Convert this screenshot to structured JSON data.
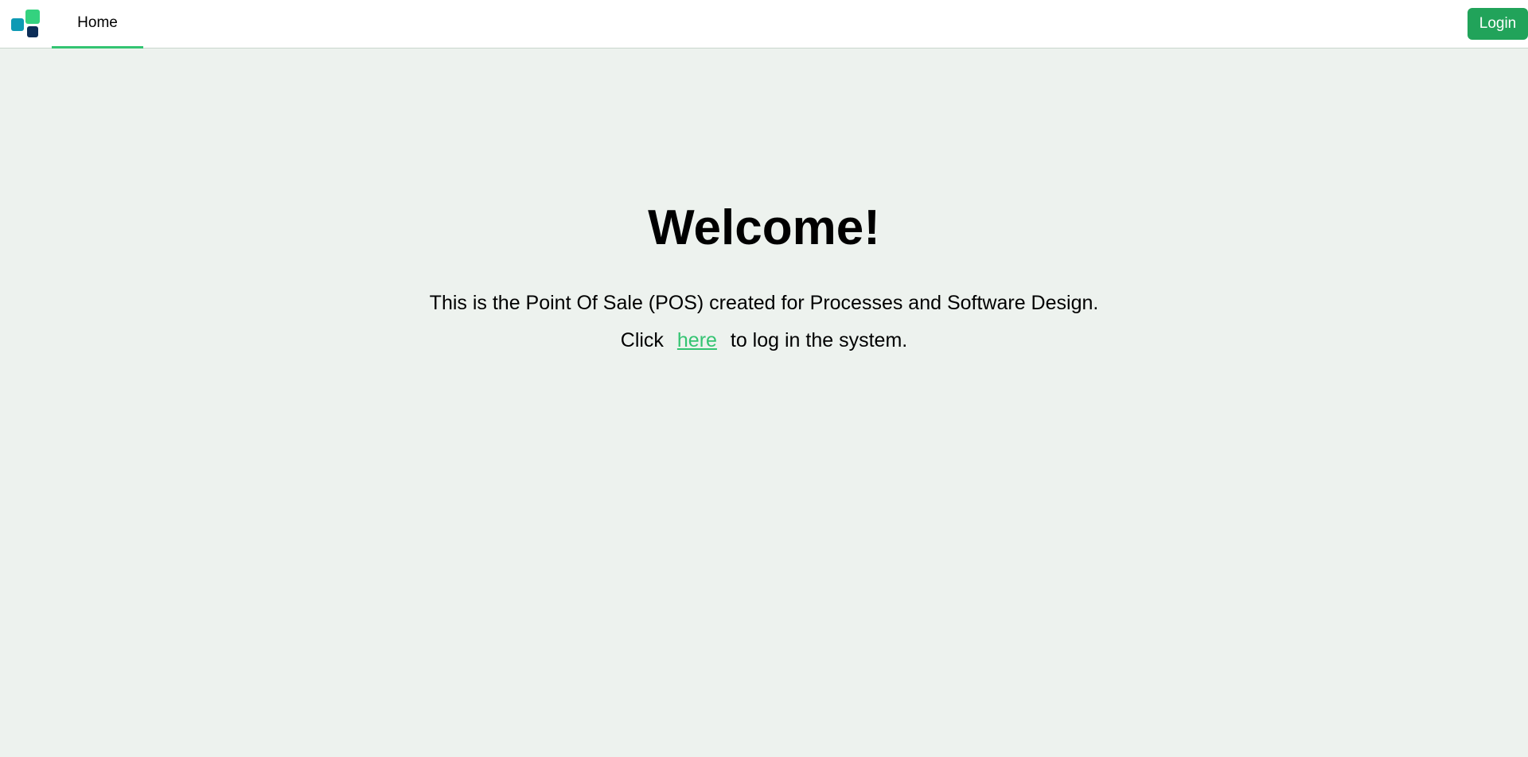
{
  "navbar": {
    "home_tab": "Home",
    "login_button": "Login"
  },
  "main": {
    "title": "Welcome!",
    "intro": "This is the Point Of Sale (POS) created for Processes and Software Design.",
    "login_prefix": "Click",
    "login_link": "here",
    "login_suffix": "to log in the system."
  },
  "colors": {
    "background": "#edf2ee",
    "accent_green": "#34c472",
    "login_button_bg": "#21a35a",
    "logo_teal": "#0e9ab4",
    "logo_green": "#34d27f",
    "logo_navy": "#0c2d57"
  },
  "icons": {
    "logo": "app-logo-icon"
  }
}
